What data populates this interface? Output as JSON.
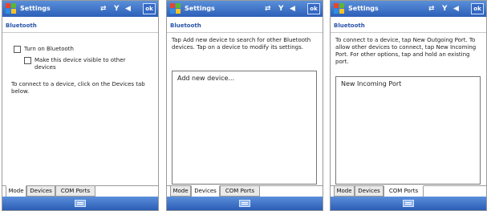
{
  "panels": [
    {
      "title": "Settings",
      "section": "Bluetooth",
      "ok": "ok",
      "checkboxes": [
        {
          "label": "Turn on Bluetooth",
          "checked": false
        },
        {
          "label": "Make this device visible to other devices",
          "checked": false
        }
      ],
      "instruction": "To connect to a device, click on the Devices tab below.",
      "tabs": [
        "Mode",
        "Devices",
        "COM Ports"
      ],
      "active_tab": "Mode"
    },
    {
      "title": "Settings",
      "section": "Bluetooth",
      "ok": "ok",
      "instruction": "Tap Add new device to search for other Bluetooth devices. Tap on a device to modify its settings.",
      "list_item": "Add new device...",
      "tabs": [
        "Mode",
        "Devices",
        "COM Ports"
      ],
      "active_tab": "Devices"
    },
    {
      "title": "Settings",
      "section": "Bluetooth",
      "ok": "ok",
      "instruction": "To connect to a device, tap New Outgoing Port. To allow other devices to connect, tap New Incoming Port. For other options, tap and hold an existing port.",
      "list_item": "New Incoming Port",
      "tabs": [
        "Mode",
        "Devices",
        "COM Ports"
      ],
      "active_tab": "COM Ports"
    }
  ],
  "icons": {
    "start": "windows-flag-icon",
    "connectivity": "sync-arrows-icon",
    "signal": "antenna-signal-icon",
    "volume": "speaker-volume-icon",
    "keyboard": "keyboard-icon"
  },
  "colors": {
    "title_bar": "#2c5fb8",
    "section_title": "#2753a8"
  }
}
